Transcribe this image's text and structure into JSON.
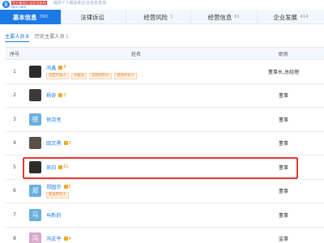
{
  "logo": {
    "mark": "企",
    "line1": "官方备案企业征信机构",
    "line2": "Qcc.com"
  },
  "breadcrumb": "提供个人股东和企业信息查询",
  "tabs": [
    {
      "label": "基本信息",
      "count": "390",
      "active": true
    },
    {
      "label": "法律诉讼",
      "count": "",
      "active": false
    },
    {
      "label": "经营风险",
      "count": "1",
      "active": false
    },
    {
      "label": "经营信息",
      "count": "61",
      "active": false
    },
    {
      "label": "企业发展",
      "count": "414",
      "active": false
    }
  ],
  "subtabs": [
    {
      "label": "主要人员",
      "count": "8",
      "active": true
    },
    {
      "label": "历史主要人员",
      "count": "1",
      "active": false
    }
  ],
  "table": {
    "headers": {
      "index": "序号",
      "name": "姓名",
      "position": "职务"
    },
    "rows": [
      {
        "index": "1",
        "avatar_text": "",
        "name": "冯鑫",
        "badge_count": "6",
        "tags": [
          "法定代表人",
          "大股东",
          "实际控制人",
          "受益所有人"
        ],
        "position": "董事长,总经理"
      },
      {
        "index": "2",
        "avatar_text": "",
        "name": "杨奇",
        "badge_count": "3",
        "tags": [],
        "position": "董事"
      },
      {
        "index": "3",
        "avatar_text": "徐",
        "name": "徐尧亮",
        "badge_count": "",
        "tags": [],
        "position": "董事"
      },
      {
        "index": "4",
        "avatar_text": "",
        "name": "田文勇",
        "badge_count": "3",
        "tags": [],
        "position": "董事"
      },
      {
        "index": "5",
        "avatar_text": "",
        "name": "吴曰",
        "badge_count": "61",
        "tags": [],
        "position": "董事"
      },
      {
        "index": "6",
        "avatar_text": "郑",
        "name": "郑园宗",
        "badge_count": "5",
        "tags": [
          "受益所有人"
        ],
        "position": "董事"
      },
      {
        "index": "7",
        "avatar_text": "马",
        "name": "马新的",
        "badge_count": "",
        "tags": [],
        "position": "董事"
      },
      {
        "index": "8",
        "avatar_text": "冯",
        "name": "冯正平",
        "badge_count": "4",
        "tags": [],
        "position": "监事"
      }
    ]
  },
  "colors": {
    "accent": "#1c7ae6",
    "highlight": "#e53935",
    "tag": "#e67e22"
  }
}
